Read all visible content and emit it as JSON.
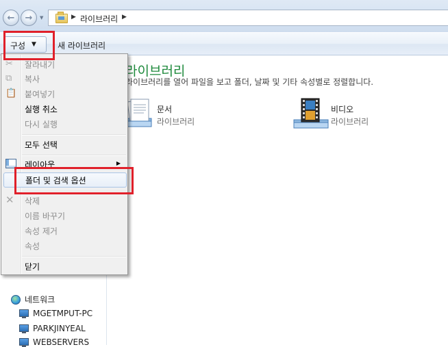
{
  "address_bar": {
    "crumb": "라이브러리"
  },
  "command_bar": {
    "organize_label": "구성",
    "new_library_label": "새 라이브러리"
  },
  "library": {
    "title": "라이브러리",
    "description": "라이브러리를 열어 파일을 보고 폴더, 날짜 및 기타 속성별로 정렬합니다.",
    "items": [
      {
        "name": "문서",
        "type": "라이브러리",
        "icon": "documents-library-icon"
      },
      {
        "name": "비디오",
        "type": "라이브러리",
        "icon": "videos-library-icon"
      }
    ]
  },
  "menu": {
    "items": [
      {
        "label": "잘라내기",
        "enabled": false
      },
      {
        "label": "복사",
        "enabled": false
      },
      {
        "label": "붙여넣기",
        "enabled": false
      },
      {
        "label": "실행 취소",
        "enabled": true
      },
      {
        "label": "다시 실행",
        "enabled": false
      },
      {
        "label": "모두 선택",
        "enabled": true
      },
      {
        "label": "레이아웃",
        "enabled": true,
        "submenu": true
      },
      {
        "label": "폴더 및 검색 옵션",
        "enabled": true,
        "highlighted": true
      },
      {
        "label": "삭제",
        "enabled": false
      },
      {
        "label": "이름 바꾸기",
        "enabled": false
      },
      {
        "label": "속성 제거",
        "enabled": false
      },
      {
        "label": "속성",
        "enabled": false
      },
      {
        "label": "닫기",
        "enabled": true
      }
    ]
  },
  "navigation": {
    "network_label": "네트워크",
    "computers": [
      "MGETMPUT-PC",
      "PARKJINYEAL",
      "WEBSERVERS"
    ]
  },
  "colors": {
    "highlight_box": "#e0202a",
    "library_title": "#1e8a3c"
  }
}
